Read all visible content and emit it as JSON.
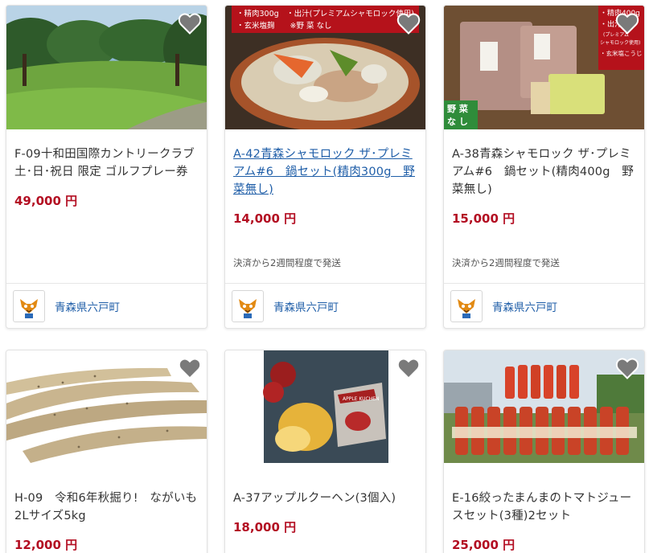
{
  "items": [
    {
      "title": "F-09十和田国際カントリークラブ　土･日･祝日 限定 ゴルフプレー券",
      "price": "49,000 円",
      "shipping": "",
      "municipality": "青森県六戸町"
    },
    {
      "title": "A-42青森シャモロック ザ･プレミアム#6　鍋セット(精肉300g　野菜無し)",
      "price": "14,000 円",
      "shipping": "決済から2週間程度で発送",
      "municipality": "青森県六戸町",
      "image_text": {
        "line1": "・精肉300g　・出汁(プレミアムシャモロック使用)",
        "line2": "・玄米塩麹　　※野 菜 なし"
      }
    },
    {
      "title": "A-38青森シャモロック ザ･プレミアム#6　鍋セット(精肉400g　野菜無し)",
      "price": "15,000 円",
      "shipping": "決済から2週間程度で発送",
      "municipality": "青森県六戸町",
      "image_text": {
        "line1": "・精肉400g",
        "line2": "・出汁",
        "line3": "(プレミアム",
        "line4": "シャモロック使用)",
        "line5": "・玄米塩こうじ",
        "badge1": "野 菜",
        "badge2": "な し"
      }
    },
    {
      "title": "H-09　令和6年秋掘り!　ながいも　2Lサイズ5kg",
      "price": "12,000 円",
      "shipping": "",
      "municipality": ""
    },
    {
      "title": "A-37アップルクーヘン(3個入)",
      "price": "18,000 円",
      "shipping": "",
      "municipality": "",
      "image_text": {
        "box": "APPLE KUCHEN"
      }
    },
    {
      "title": "E-16絞ったまんまのトマトジュースセット(3種)2セット",
      "price": "25,000 円",
      "shipping": "",
      "municipality": ""
    }
  ],
  "colors": {
    "price": "#b30e22",
    "link": "#1f5ea8",
    "heart": "#7a7a7a"
  }
}
